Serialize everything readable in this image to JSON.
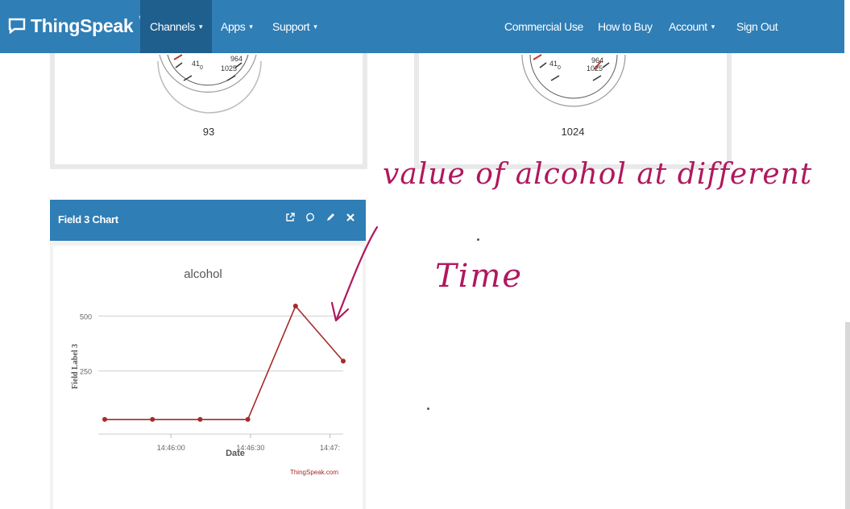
{
  "navbar": {
    "brand": "ThingSpeak",
    "brand_tm": "™",
    "left_items": [
      {
        "label": "Channels",
        "caret": "▾"
      },
      {
        "label": "Apps",
        "caret": "▾"
      },
      {
        "label": "Support",
        "caret": "▾"
      }
    ],
    "right_items": [
      {
        "label": "Commercial Use"
      },
      {
        "label": "How to Buy"
      },
      {
        "label": "Account",
        "caret": "▾"
      },
      {
        "label": "Sign Out"
      }
    ]
  },
  "gauges": [
    {
      "value": "93",
      "tick_labels": [
        "41",
        "0",
        "1025",
        "964",
        "0"
      ]
    },
    {
      "value": "1024",
      "tick_labels": [
        "41",
        "0",
        "1025",
        "964"
      ]
    }
  ],
  "chart_panel": {
    "title": "Field 3 Chart",
    "action_icons": [
      "external-link-icon",
      "comment-icon",
      "pencil-icon",
      "close-icon"
    ]
  },
  "chart_data": {
    "type": "line",
    "title": "alcohol",
    "xlabel": "Date",
    "ylabel": "Field Label 3",
    "credit": "ThingSpeak.com",
    "y_ticks": [
      250,
      500
    ],
    "x_ticks": [
      "14:46:00",
      "14:46:30",
      "14:47:"
    ],
    "ylim": [
      0,
      600
    ],
    "series": [
      {
        "color": "#a52a2a",
        "x": [
          "14:45:35",
          "14:45:53",
          "14:46:11",
          "14:46:29",
          "14:46:47",
          "14:47:05"
        ],
        "values": [
          30,
          30,
          30,
          30,
          545,
          295
        ]
      }
    ]
  },
  "annotation": {
    "line1": "value of alcohol at different",
    "line2": "Time",
    "color": "#b0185e"
  },
  "colors": {
    "navbar": "#2f7eb6",
    "navbar_active": "#1f5f8e",
    "series": "#a52a2a"
  }
}
